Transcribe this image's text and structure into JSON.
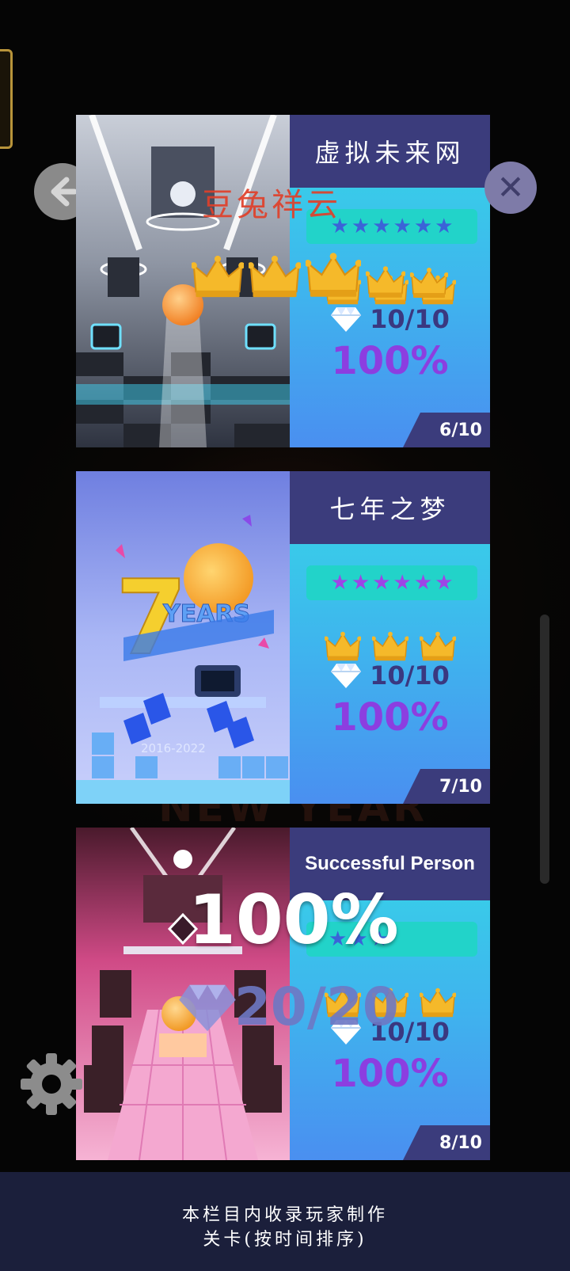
{
  "colors": {
    "card_header": "#3b3c7c",
    "card_gradient_top": "#35d9e6",
    "card_gradient_bottom": "#4a8ff0",
    "star_box": "#22d3c9",
    "percent_text": "#8c3ee0",
    "crown_gold": "#f5b92a",
    "footer_bg": "#1b1f3b"
  },
  "icons": {
    "back": "arrow-left-icon",
    "close": "close-icon",
    "settings": "gear-icon",
    "gem": "diamond-icon",
    "crown": "crown-icon",
    "star": "star-icon"
  },
  "levels": [
    {
      "title": "虚拟未来网",
      "stars": 6,
      "crowns": 3,
      "gems": "10/10",
      "percent": "100%",
      "page": "6/10",
      "star_color": "#3b63d8"
    },
    {
      "title": "七年之梦",
      "stars": 6,
      "crowns": 3,
      "gems": "10/10",
      "percent": "100%",
      "page": "7/10",
      "star_color": "#9d45e6"
    },
    {
      "title": "Successful Person",
      "stars": 3,
      "crowns": 3,
      "gems": "10/10",
      "percent": "100%",
      "page": "8/10",
      "star_color": "#3b63d8"
    }
  ],
  "art": {
    "years_text": "YEARS",
    "seven": "7",
    "date_range": "2016-2022"
  },
  "overlays": {
    "watermark": "豆兔祥云",
    "percent": "100%",
    "gem_count": "20/20",
    "crowns": 5
  },
  "background_text": "NEW YEAR",
  "footer": {
    "line1": "本栏目内收录玩家制作",
    "line2": "关卡(按时间排序)"
  }
}
